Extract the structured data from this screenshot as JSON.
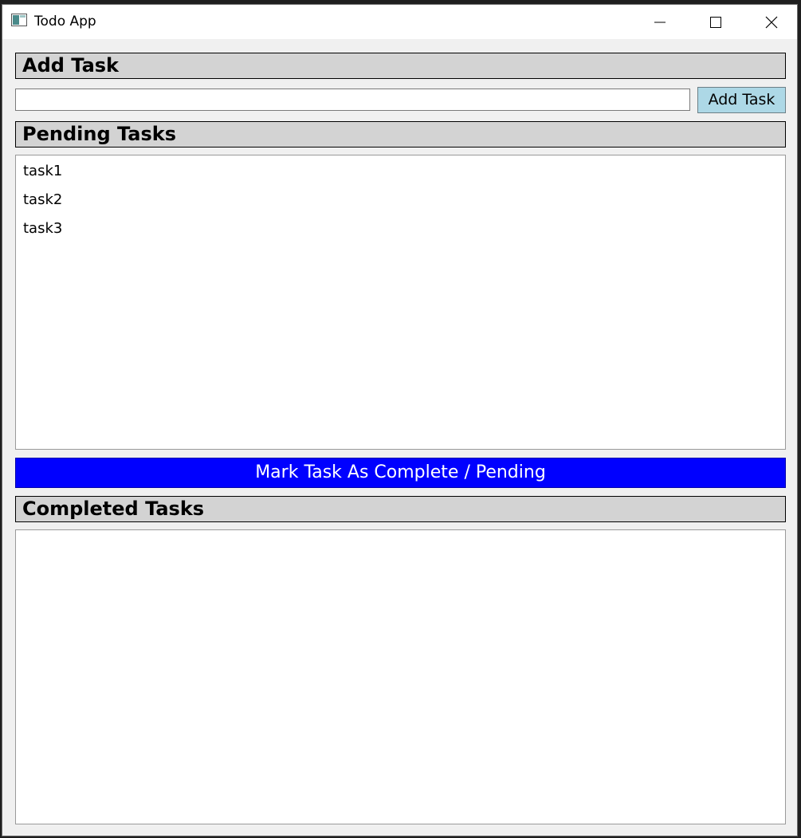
{
  "window": {
    "title": "Todo App",
    "controls": {
      "minimize": "minimize-icon",
      "maximize": "maximize-icon",
      "close": "close-icon"
    }
  },
  "add_section": {
    "header": "Add Task",
    "input_value": "",
    "input_placeholder": "",
    "button_label": "Add Task"
  },
  "pending_section": {
    "header": "Pending Tasks",
    "items": [
      "task1",
      "task2",
      "task3"
    ]
  },
  "mark_button": {
    "label": "Mark Task As Complete / Pending"
  },
  "completed_section": {
    "header": "Completed Tasks",
    "items": []
  },
  "colors": {
    "header_bg": "#d3d3d3",
    "add_button_bg": "#add8e6",
    "mark_button_bg": "#0000ff",
    "mark_button_text": "#ffffff",
    "window_bg": "#f0f0f0"
  }
}
